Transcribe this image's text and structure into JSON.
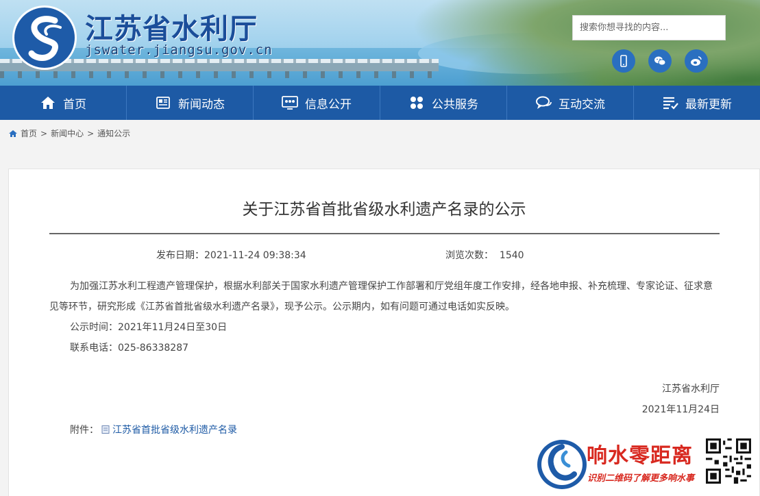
{
  "header": {
    "site_title": "江苏省水利厅",
    "site_url": "jswater.jiangsu.gov.cn",
    "search_placeholder": "搜索你想寻找的内容..."
  },
  "nav": [
    {
      "label": "首页",
      "icon": "home-icon"
    },
    {
      "label": "新闻动态",
      "icon": "news-icon"
    },
    {
      "label": "信息公开",
      "icon": "info-board-icon"
    },
    {
      "label": "公共服务",
      "icon": "grid-icon"
    },
    {
      "label": "互动交流",
      "icon": "chat-icon"
    },
    {
      "label": "最新更新",
      "icon": "list-check-icon"
    }
  ],
  "breadcrumb": {
    "home": "首页",
    "news": "新闻中心",
    "notice": "通知公示"
  },
  "article": {
    "title": "关于江苏省首批省级水利遗产名录的公示",
    "date_label": "发布日期：",
    "date": "2021-11-24 09:38:34",
    "views_label": "浏览次数：",
    "views": "1540",
    "paragraph": "为加强江苏水利工程遗产管理保护，根据水利部关于国家水利遗产管理保护工作部署和厅党组年度工作安排，经各地申报、补充梳理、专家论证、征求意见等环节，研究形成《江苏省首批省级水利遗产名录》，现予公示。公示期内，如有问题可通过电话如实反映。",
    "period": "公示时间：2021年11月24日至30日",
    "phone": "联系电话：025-86338287",
    "signature_org": "江苏省水利厅",
    "signature_date": "2021年11月24日",
    "attachment_label": "附件：",
    "attachment_link": "江苏省首批省级水利遗产名录"
  },
  "watermark": {
    "title": "响水零距离",
    "subtitle": "识别二维码了解更多响水事"
  },
  "colors": {
    "nav_bg": "#1d5aa5",
    "link": "#1d5aa5",
    "watermark": "#d8281f"
  }
}
